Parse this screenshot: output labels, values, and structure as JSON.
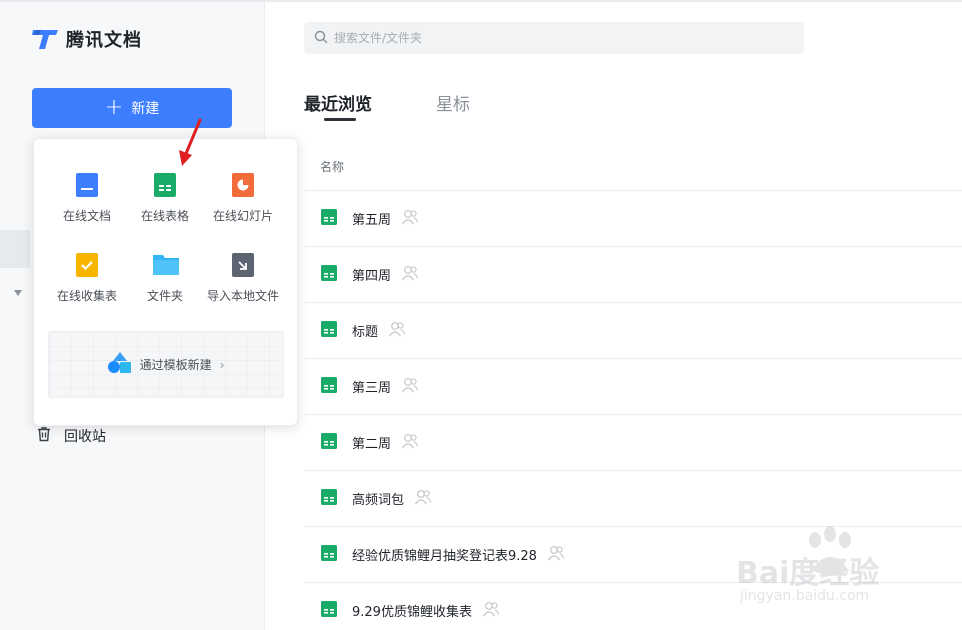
{
  "app": {
    "name": "腾讯文档"
  },
  "sidebar": {
    "new_button_label": "新建",
    "trash_label": "回收站"
  },
  "new_menu": {
    "items": [
      {
        "label": "在线文档",
        "icon": "doc-icon",
        "color": "#3d7eff"
      },
      {
        "label": "在线表格",
        "icon": "sheet-icon",
        "color": "#1aab68"
      },
      {
        "label": "在线幻灯片",
        "icon": "slides-icon",
        "color": "#f26b3a"
      },
      {
        "label": "在线收集表",
        "icon": "form-icon",
        "color": "#f7b500"
      },
      {
        "label": "文件夹",
        "icon": "folder-icon",
        "color": "#33b4f5"
      },
      {
        "label": "导入本地文件",
        "icon": "import-icon",
        "color": "#5c6472"
      }
    ],
    "template_label": "通过模板新建",
    "template_arrow": "›"
  },
  "search": {
    "placeholder": "搜索文件/文件夹"
  },
  "tabs": [
    {
      "label": "最近浏览",
      "active": true
    },
    {
      "label": "星标",
      "active": false
    }
  ],
  "list": {
    "column_name": "名称",
    "files": [
      {
        "name": "第五周"
      },
      {
        "name": "第四周"
      },
      {
        "name": "标题"
      },
      {
        "name": "第三周"
      },
      {
        "name": "第二周"
      },
      {
        "name": "高频词包"
      },
      {
        "name": "经验优质锦鲤月抽奖登记表9.28"
      },
      {
        "name": "9.29优质锦鲤收集表"
      }
    ]
  },
  "watermark": {
    "brand": "Bai度经验",
    "url": "jingyan.baidu.com"
  },
  "colors": {
    "accent": "#3d7eff",
    "annotation": "#e02020",
    "sheet_green": "#1aab68"
  }
}
